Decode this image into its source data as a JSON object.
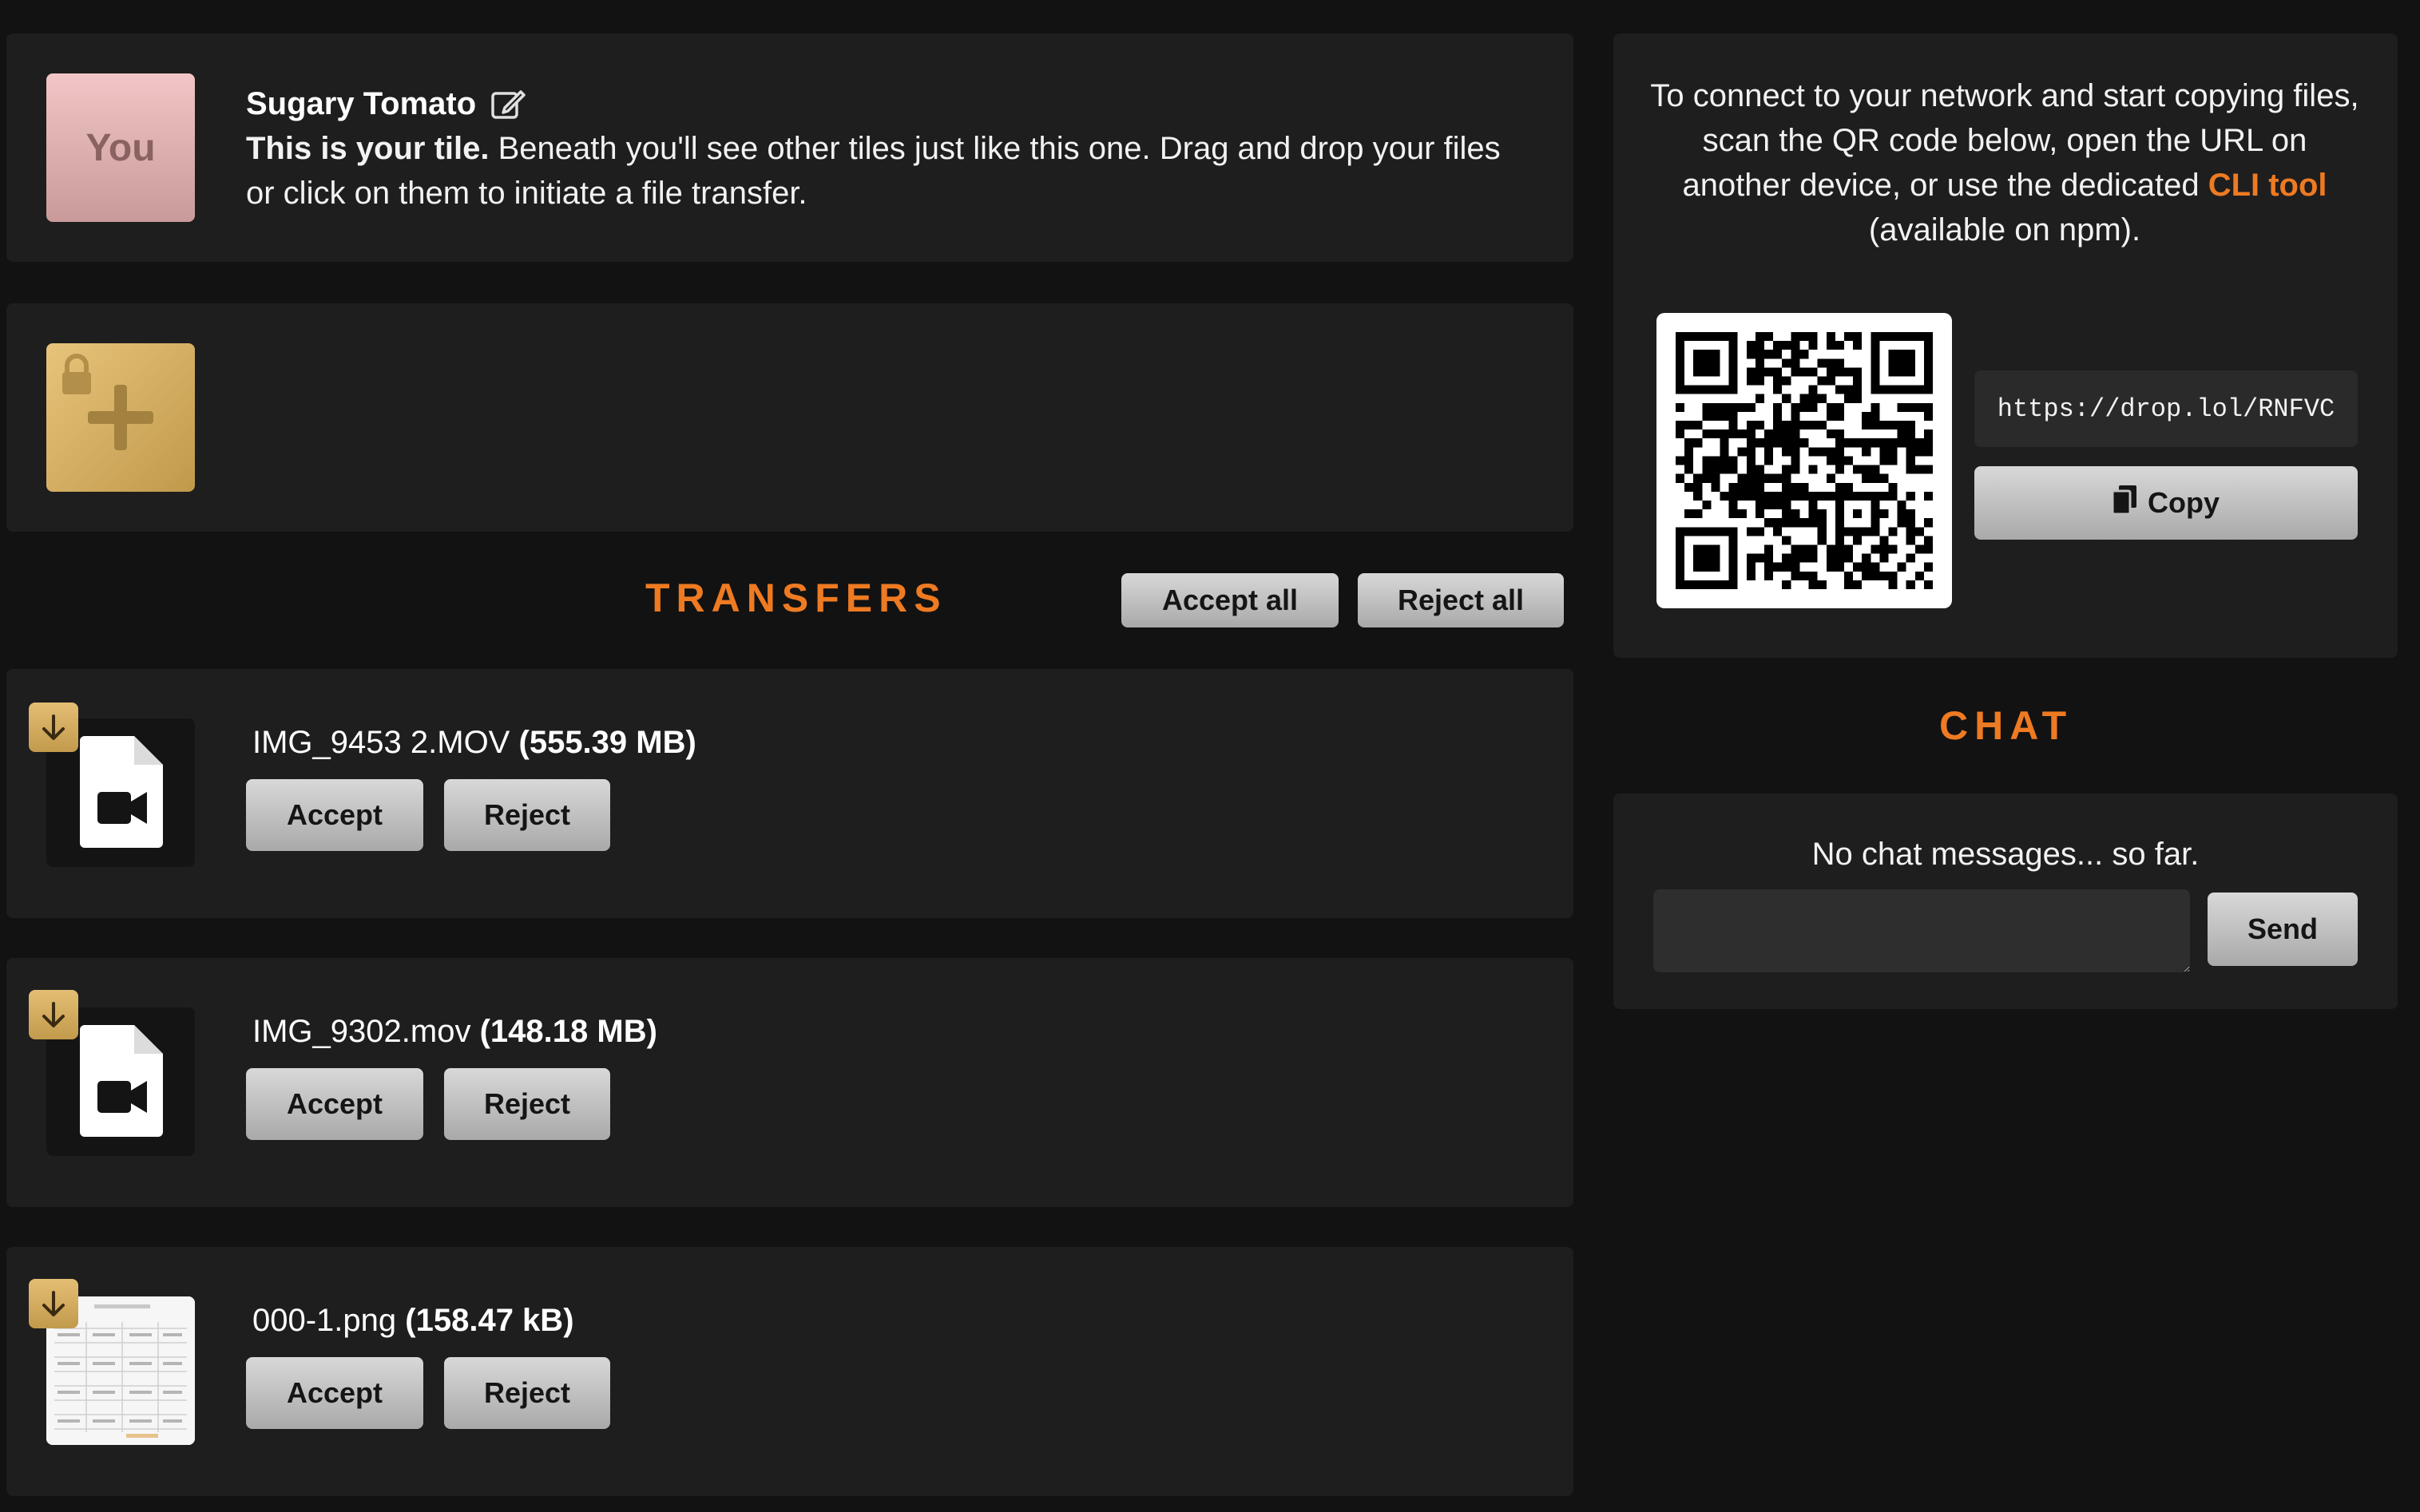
{
  "self_tile": {
    "avatar_label": "You",
    "name": "Sugary Tomato",
    "intro_bold": "This is your tile.",
    "intro_rest": " Beneath you'll see other tiles just like this one. Drag and drop your files or click on them to initiate a file transfer."
  },
  "transfers": {
    "heading": "TRANSFERS",
    "accept_all": "Accept all",
    "reject_all": "Reject all",
    "items": [
      {
        "name": "IMG_9453 2.MOV",
        "size": "(555.39 MB)",
        "accept": "Accept",
        "reject": "Reject",
        "thumb": "video-file-icon"
      },
      {
        "name": "IMG_9302.mov",
        "size": "(148.18 MB)",
        "accept": "Accept",
        "reject": "Reject",
        "thumb": "video-file-icon"
      },
      {
        "name": "000-1.png",
        "size": "(158.47 kB)",
        "accept": "Accept",
        "reject": "Reject",
        "thumb": "image-thumbnail"
      }
    ]
  },
  "connect": {
    "text_before": "To connect to your network and start copying files, scan the QR code below, open the URL on another device, or use the dedicated ",
    "link": "CLI tool",
    "text_after": " (available on npm).",
    "url": "https://drop.lol/RNFVC",
    "copy": "Copy"
  },
  "chat": {
    "heading": "CHAT",
    "empty": "No chat messages... so far.",
    "input_value": "",
    "send": "Send"
  },
  "colors": {
    "accent": "#ee7a22",
    "background": "#121212",
    "panel": "#1e1e1e",
    "gold": "#d4ad5e"
  }
}
